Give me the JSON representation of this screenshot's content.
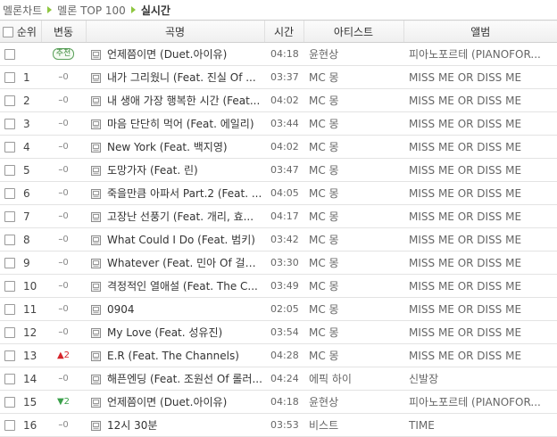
{
  "breadcrumb": [
    "멜론차트",
    "멜론 TOP 100",
    "실시간"
  ],
  "header": {
    "rank": "순위",
    "change": "변동",
    "title": "곡명",
    "time": "시간",
    "artist": "아티스트",
    "album": "앨범"
  },
  "rows": [
    {
      "rank": "",
      "change_type": "recommend",
      "change": "추천",
      "title": "언제쯤이면 (Duet.아이유)",
      "time": "04:18",
      "artist": "윤현상",
      "album": "피아노포르테 (PIANOFOR..."
    },
    {
      "rank": "1",
      "change_type": "same",
      "change": "0",
      "title": "내가 그리웠니 (Feat. 진실 Of ...",
      "time": "03:37",
      "artist": "MC 몽",
      "album": "MISS ME OR DISS ME"
    },
    {
      "rank": "2",
      "change_type": "same",
      "change": "0",
      "title": "내 생애 가장 행복한 시간 (Feat...",
      "time": "04:02",
      "artist": "MC 몽",
      "album": "MISS ME OR DISS ME"
    },
    {
      "rank": "3",
      "change_type": "same",
      "change": "0",
      "title": "마음 단단히 먹어 (Feat. 에일리)",
      "time": "03:44",
      "artist": "MC 몽",
      "album": "MISS ME OR DISS ME"
    },
    {
      "rank": "4",
      "change_type": "same",
      "change": "0",
      "title": "New York (Feat. 백지영)",
      "time": "04:02",
      "artist": "MC 몽",
      "album": "MISS ME OR DISS ME"
    },
    {
      "rank": "5",
      "change_type": "same",
      "change": "0",
      "title": "도망가자 (Feat. 린)",
      "time": "03:47",
      "artist": "MC 몽",
      "album": "MISS ME OR DISS ME"
    },
    {
      "rank": "6",
      "change_type": "same",
      "change": "0",
      "title": "죽을만큼 아파서 Part.2 (Feat. ...",
      "time": "04:05",
      "artist": "MC 몽",
      "album": "MISS ME OR DISS ME"
    },
    {
      "rank": "7",
      "change_type": "same",
      "change": "0",
      "title": "고장난 선풍기 (Feat. 개리, 효...",
      "time": "04:17",
      "artist": "MC 몽",
      "album": "MISS ME OR DISS ME"
    },
    {
      "rank": "8",
      "change_type": "same",
      "change": "0",
      "title": "What Could I Do (Feat. 범키)",
      "time": "03:42",
      "artist": "MC 몽",
      "album": "MISS ME OR DISS ME"
    },
    {
      "rank": "9",
      "change_type": "same",
      "change": "0",
      "title": "Whatever (Feat. 민아 Of 걸스...",
      "time": "03:30",
      "artist": "MC 몽",
      "album": "MISS ME OR DISS ME"
    },
    {
      "rank": "10",
      "change_type": "same",
      "change": "0",
      "title": "격정적인 열애설 (Feat. The C...",
      "time": "03:49",
      "artist": "MC 몽",
      "album": "MISS ME OR DISS ME"
    },
    {
      "rank": "11",
      "change_type": "same",
      "change": "0",
      "title": "0904",
      "time": "02:05",
      "artist": "MC 몽",
      "album": "MISS ME OR DISS ME"
    },
    {
      "rank": "12",
      "change_type": "same",
      "change": "0",
      "title": "My Love (Feat. 성유진)",
      "time": "03:54",
      "artist": "MC 몽",
      "album": "MISS ME OR DISS ME"
    },
    {
      "rank": "13",
      "change_type": "up",
      "change": "2",
      "title": "E.R (Feat. The Channels)",
      "time": "04:28",
      "artist": "MC 몽",
      "album": "MISS ME OR DISS ME"
    },
    {
      "rank": "14",
      "change_type": "same",
      "change": "0",
      "title": "해픈엔딩 (Feat. 조원선 Of 롤러...",
      "time": "04:24",
      "artist": "에픽 하이",
      "album": "신발장"
    },
    {
      "rank": "15",
      "change_type": "down",
      "change": "2",
      "title": "언제쯤이면 (Duet.아이유)",
      "time": "04:18",
      "artist": "윤현상",
      "album": "피아노포르테 (PIANOFOR..."
    },
    {
      "rank": "16",
      "change_type": "same",
      "change": "0",
      "title": "12시 30분",
      "time": "03:53",
      "artist": "비스트",
      "album": "TIME"
    }
  ]
}
